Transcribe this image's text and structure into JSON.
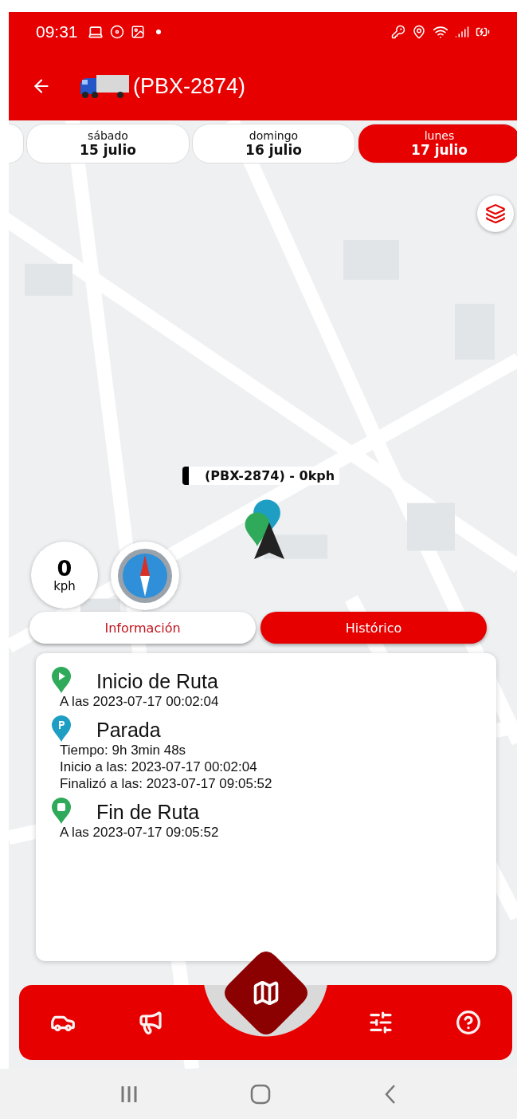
{
  "status_bar": {
    "time": "09:31"
  },
  "app_bar": {
    "title": "(PBX-2874)"
  },
  "dates": [
    {
      "weekday": "sábado",
      "day": "15 julio",
      "selected": false
    },
    {
      "weekday": "domingo",
      "day": "16 julio",
      "selected": false
    },
    {
      "weekday": "lunes",
      "day": "17 julio",
      "selected": true
    }
  ],
  "map": {
    "vehicle_label": "(PBX-2874) - 0kph"
  },
  "speed": {
    "value": "0",
    "unit": "kph"
  },
  "info_tabs": [
    {
      "label": "Información",
      "selected": false
    },
    {
      "label": "Histórico",
      "selected": true
    }
  ],
  "history": [
    {
      "kind": "start",
      "title": "Inicio de Ruta",
      "lines": [
        "A las 2023-07-17 00:02:04"
      ]
    },
    {
      "kind": "stop",
      "title": "Parada",
      "lines": [
        "Tiempo: 9h 3min 48s",
        "Inicio a las: 2023-07-17 00:02:04",
        "Finalizó a las: 2023-07-17 09:05:52"
      ]
    },
    {
      "kind": "end",
      "title": "Fin de Ruta",
      "lines": [
        "A las 2023-07-17 09:05:52"
      ]
    }
  ],
  "bottom_nav": [
    {
      "kind": "car",
      "selected": false
    },
    {
      "kind": "megaphone",
      "selected": false
    },
    {
      "kind": "map",
      "selected": true
    },
    {
      "kind": "sliders",
      "selected": false
    },
    {
      "kind": "help",
      "selected": false
    }
  ]
}
